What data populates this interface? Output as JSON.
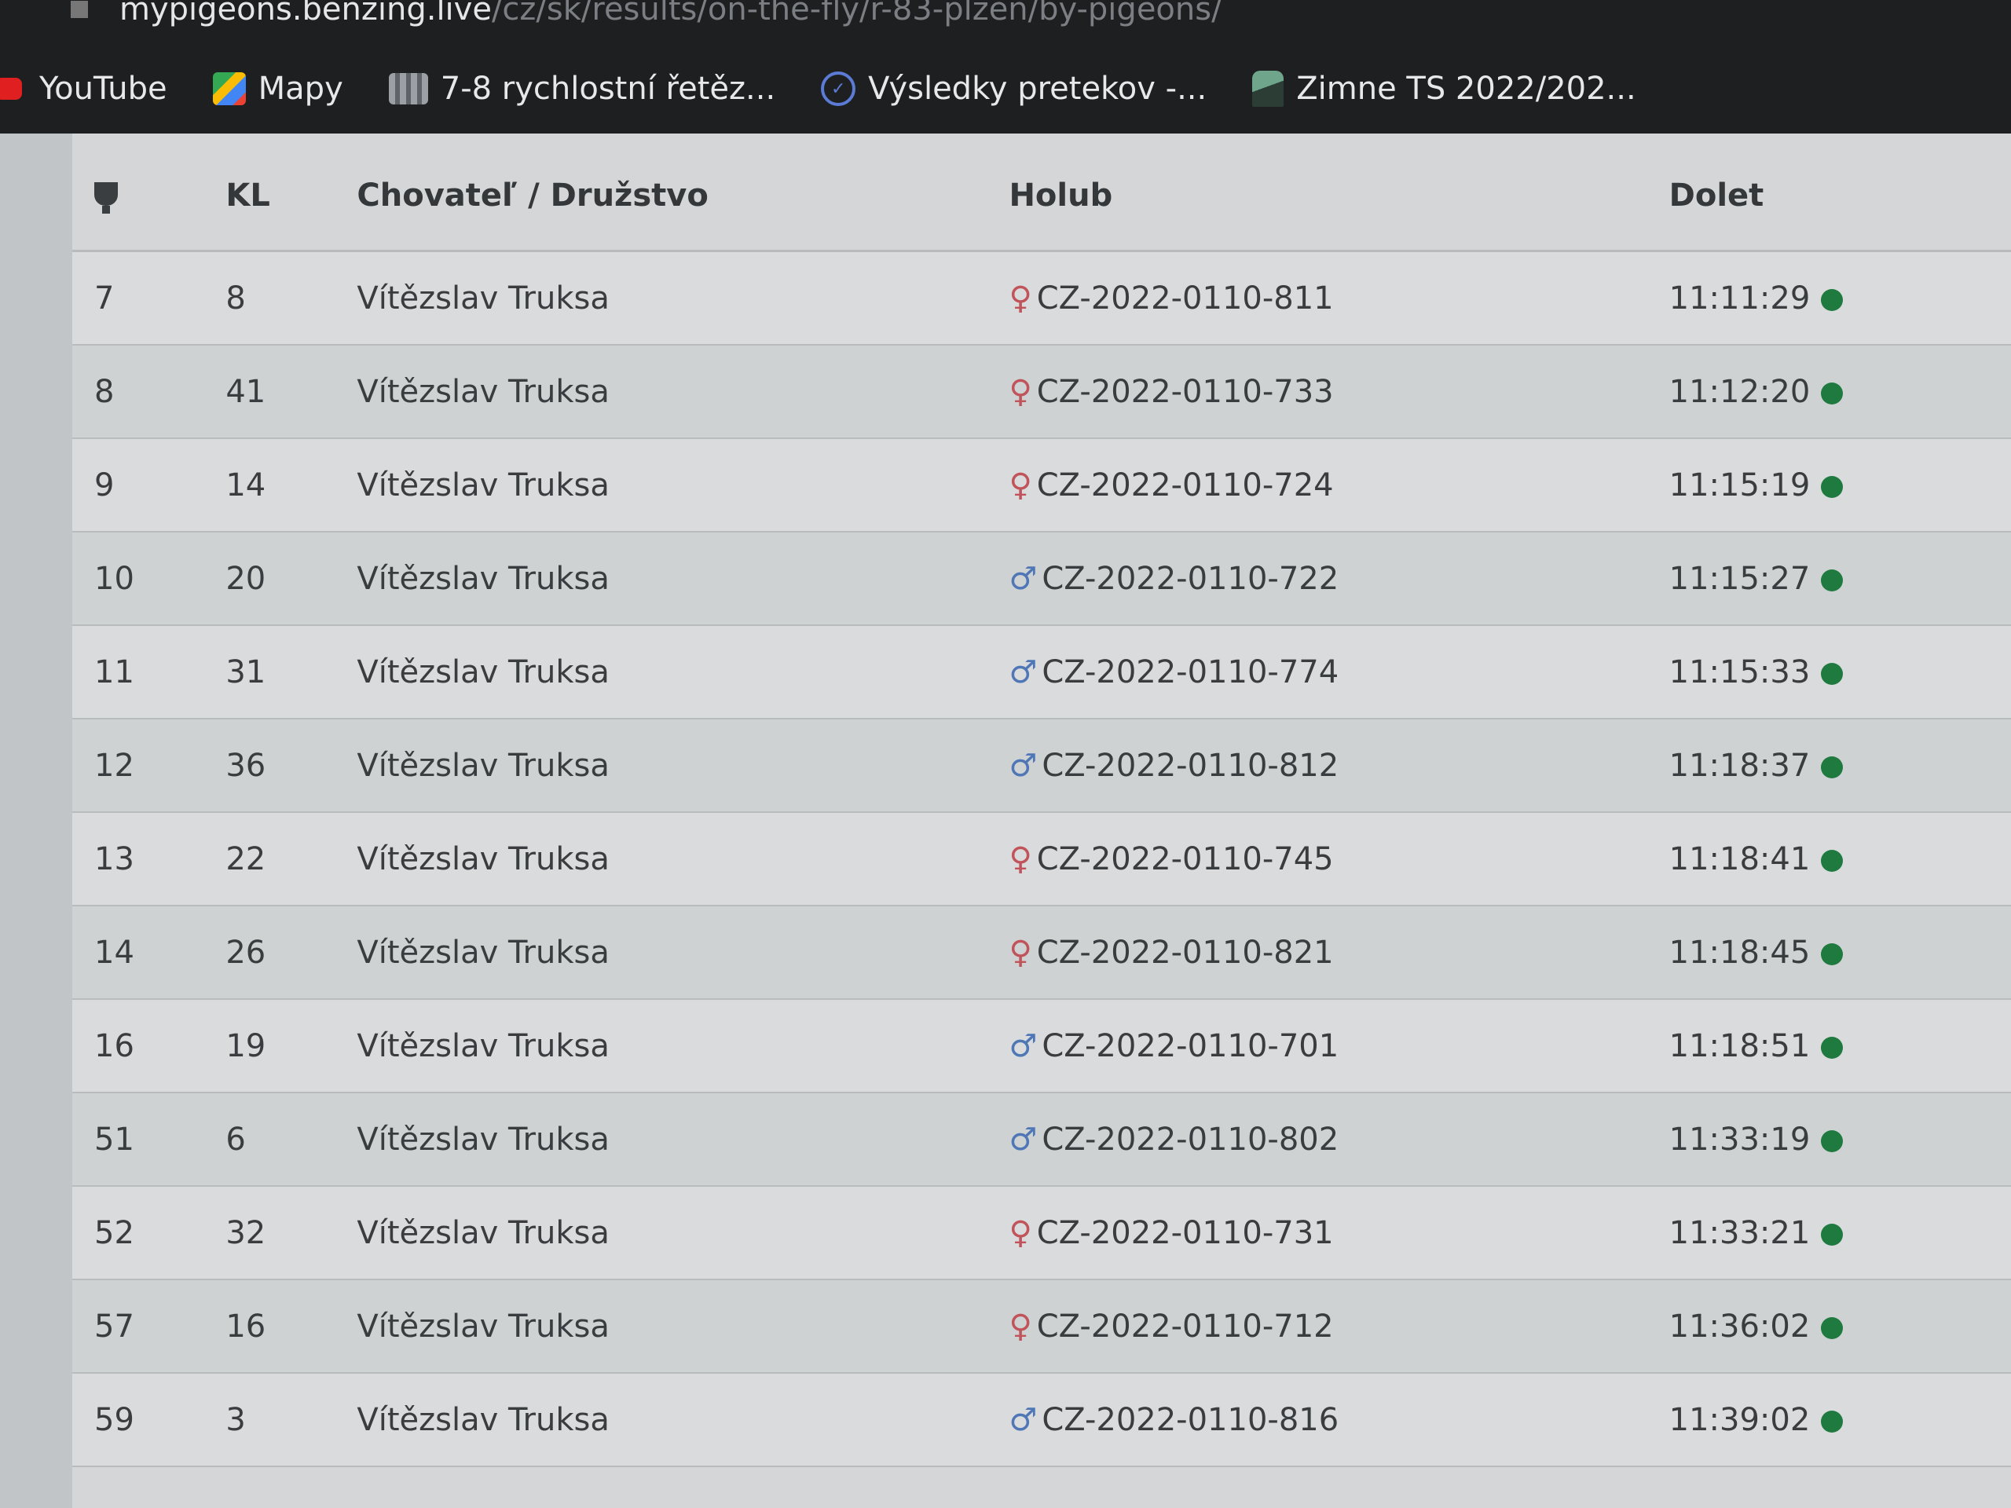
{
  "browser": {
    "url_domain": "mypigeons.benzing.live",
    "url_path": "/cz/sk/results/on-the-fly/r-83-plzen/by-pigeons/",
    "bookmarks": [
      {
        "label": "YouTube",
        "icon": "youtube-icon"
      },
      {
        "label": "Mapy",
        "icon": "maps-icon"
      },
      {
        "label": "7-8 rychlostní řetěz...",
        "icon": "chain-icon"
      },
      {
        "label": "Výsledky pretekov -...",
        "icon": "results-icon"
      },
      {
        "label": "Zimne TS 2022/202...",
        "icon": "pigeon-icon"
      }
    ]
  },
  "table": {
    "headers": {
      "rank_icon": "trophy-icon",
      "kl": "KL",
      "breeder": "Chovateľ / Družstvo",
      "pigeon": "Holub",
      "arrival": "Dolet"
    },
    "rows": [
      {
        "rank": "7",
        "kl": "8",
        "breeder": "Vítězslav Truksa",
        "sex": "female",
        "sex_symbol": "♀",
        "pigeon": "CZ-2022-0110-811",
        "arrival": "11:11:29"
      },
      {
        "rank": "8",
        "kl": "41",
        "breeder": "Vítězslav Truksa",
        "sex": "female",
        "sex_symbol": "♀",
        "pigeon": "CZ-2022-0110-733",
        "arrival": "11:12:20"
      },
      {
        "rank": "9",
        "kl": "14",
        "breeder": "Vítězslav Truksa",
        "sex": "female",
        "sex_symbol": "♀",
        "pigeon": "CZ-2022-0110-724",
        "arrival": "11:15:19"
      },
      {
        "rank": "10",
        "kl": "20",
        "breeder": "Vítězslav Truksa",
        "sex": "male",
        "sex_symbol": "♂",
        "pigeon": "CZ-2022-0110-722",
        "arrival": "11:15:27"
      },
      {
        "rank": "11",
        "kl": "31",
        "breeder": "Vítězslav Truksa",
        "sex": "male",
        "sex_symbol": "♂",
        "pigeon": "CZ-2022-0110-774",
        "arrival": "11:15:33"
      },
      {
        "rank": "12",
        "kl": "36",
        "breeder": "Vítězslav Truksa",
        "sex": "male",
        "sex_symbol": "♂",
        "pigeon": "CZ-2022-0110-812",
        "arrival": "11:18:37"
      },
      {
        "rank": "13",
        "kl": "22",
        "breeder": "Vítězslav Truksa",
        "sex": "female",
        "sex_symbol": "♀",
        "pigeon": "CZ-2022-0110-745",
        "arrival": "11:18:41"
      },
      {
        "rank": "14",
        "kl": "26",
        "breeder": "Vítězslav Truksa",
        "sex": "female",
        "sex_symbol": "♀",
        "pigeon": "CZ-2022-0110-821",
        "arrival": "11:18:45"
      },
      {
        "rank": "16",
        "kl": "19",
        "breeder": "Vítězslav Truksa",
        "sex": "male",
        "sex_symbol": "♂",
        "pigeon": "CZ-2022-0110-701",
        "arrival": "11:18:51"
      },
      {
        "rank": "51",
        "kl": "6",
        "breeder": "Vítězslav Truksa",
        "sex": "male",
        "sex_symbol": "♂",
        "pigeon": "CZ-2022-0110-802",
        "arrival": "11:33:19"
      },
      {
        "rank": "52",
        "kl": "32",
        "breeder": "Vítězslav Truksa",
        "sex": "female",
        "sex_symbol": "♀",
        "pigeon": "CZ-2022-0110-731",
        "arrival": "11:33:21"
      },
      {
        "rank": "57",
        "kl": "16",
        "breeder": "Vítězslav Truksa",
        "sex": "female",
        "sex_symbol": "♀",
        "pigeon": "CZ-2022-0110-712",
        "arrival": "11:36:02"
      },
      {
        "rank": "59",
        "kl": "3",
        "breeder": "Vítězslav Truksa",
        "sex": "male",
        "sex_symbol": "♂",
        "pigeon": "CZ-2022-0110-816",
        "arrival": "11:39:02"
      }
    ],
    "status_color": "#1f7a3f"
  }
}
